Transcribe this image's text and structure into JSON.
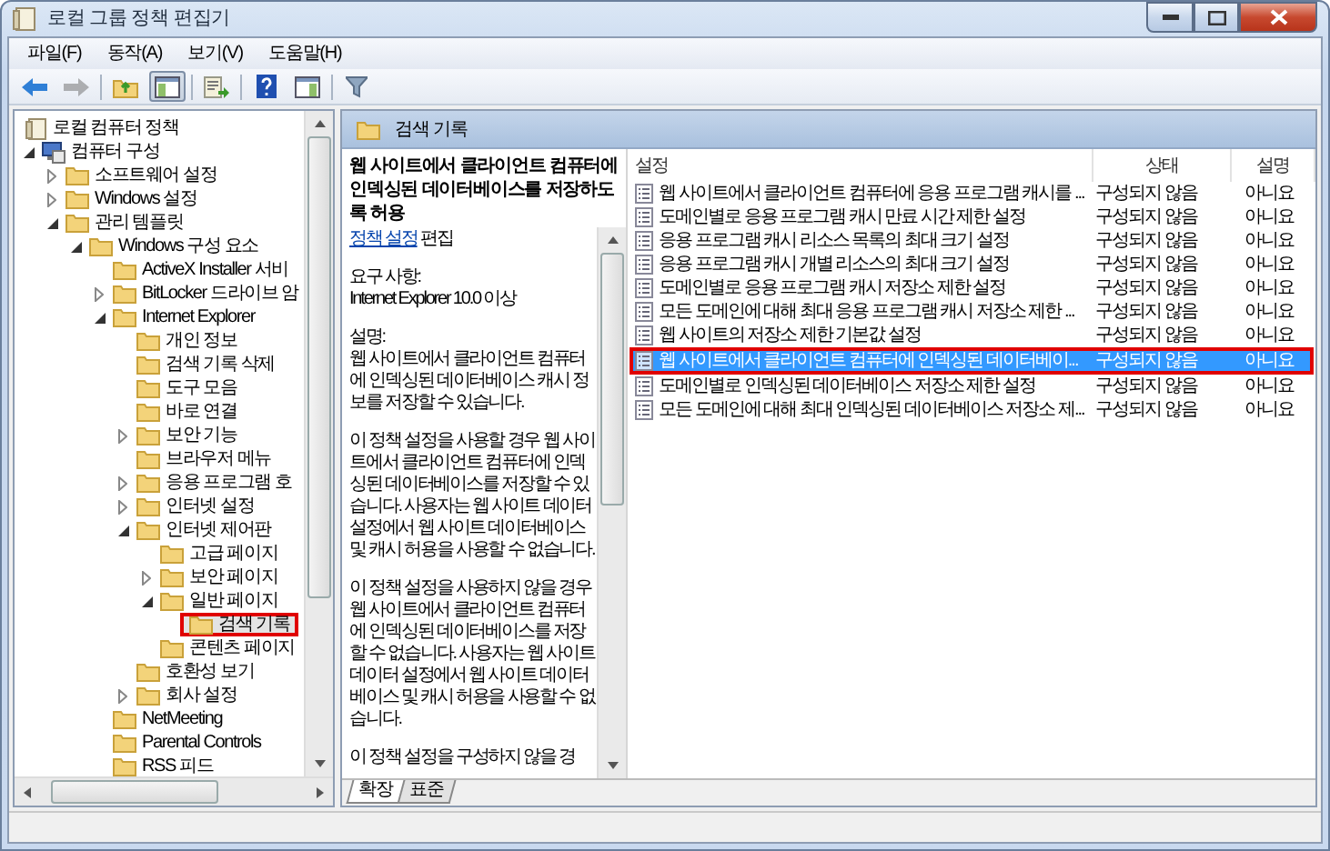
{
  "window": {
    "title": "로컬 그룹 정책 편집기"
  },
  "menu": [
    "파일(F)",
    "동작(A)",
    "보기(V)",
    "도움말(H)"
  ],
  "toolbar": [
    {
      "kind": "back",
      "disabled": false,
      "pressed": false
    },
    {
      "kind": "forward",
      "disabled": true,
      "pressed": false
    },
    {
      "kind": "sep"
    },
    {
      "kind": "up",
      "disabled": false,
      "pressed": false
    },
    {
      "kind": "tree",
      "disabled": false,
      "pressed": true
    },
    {
      "kind": "sep"
    },
    {
      "kind": "export",
      "disabled": false,
      "pressed": false
    },
    {
      "kind": "sep"
    },
    {
      "kind": "help",
      "disabled": false,
      "pressed": false
    },
    {
      "kind": "pane",
      "disabled": false,
      "pressed": false
    },
    {
      "kind": "sep"
    },
    {
      "kind": "filter",
      "disabled": false,
      "pressed": false
    }
  ],
  "tree": [
    {
      "label": "로컬 컴퓨터 정책",
      "kind": "policy",
      "selected": false,
      "highlighted": false,
      "children": [
        {
          "label": "컴퓨터 구성",
          "kind": "computer",
          "expanded": true,
          "selected": false,
          "highlighted": false,
          "children": [
            {
              "label": "소프트웨어 설정",
              "kind": "folder",
              "expanded": false,
              "selected": false,
              "highlighted": false
            },
            {
              "label": "Windows 설정",
              "kind": "folder",
              "expanded": false,
              "selected": false,
              "highlighted": false
            },
            {
              "label": "관리 템플릿",
              "kind": "folder",
              "expanded": true,
              "selected": false,
              "highlighted": false,
              "children": [
                {
                  "label": "Windows 구성 요소",
                  "kind": "folder",
                  "expanded": true,
                  "selected": false,
                  "highlighted": false,
                  "children": [
                    {
                      "label": "ActiveX Installer 서비",
                      "kind": "folder",
                      "selected": false,
                      "highlighted": false
                    },
                    {
                      "label": "BitLocker 드라이브 암",
                      "kind": "folder",
                      "expanded": false,
                      "selected": false,
                      "highlighted": false
                    },
                    {
                      "label": "Internet Explorer",
                      "kind": "folder",
                      "expanded": true,
                      "selected": false,
                      "highlighted": false,
                      "children": [
                        {
                          "label": "개인 정보",
                          "kind": "folder",
                          "selected": false,
                          "highlighted": false
                        },
                        {
                          "label": "검색 기록 삭제",
                          "kind": "folder",
                          "selected": false,
                          "highlighted": false
                        },
                        {
                          "label": "도구 모음",
                          "kind": "folder",
                          "selected": false,
                          "highlighted": false
                        },
                        {
                          "label": "바로 연결",
                          "kind": "folder",
                          "selected": false,
                          "highlighted": false
                        },
                        {
                          "label": "보안 기능",
                          "kind": "folder",
                          "expanded": false,
                          "selected": false,
                          "highlighted": false
                        },
                        {
                          "label": "브라우저 메뉴",
                          "kind": "folder",
                          "selected": false,
                          "highlighted": false
                        },
                        {
                          "label": "응용 프로그램 호",
                          "kind": "folder",
                          "expanded": false,
                          "selected": false,
                          "highlighted": false
                        },
                        {
                          "label": "인터넷 설정",
                          "kind": "folder",
                          "expanded": false,
                          "selected": false,
                          "highlighted": false
                        },
                        {
                          "label": "인터넷 제어판",
                          "kind": "folder",
                          "expanded": true,
                          "selected": false,
                          "highlighted": false,
                          "children": [
                            {
                              "label": "고급 페이지",
                              "kind": "folder",
                              "selected": false,
                              "highlighted": false
                            },
                            {
                              "label": "보안 페이지",
                              "kind": "folder",
                              "expanded": false,
                              "selected": false,
                              "highlighted": false
                            },
                            {
                              "label": "일반 페이지",
                              "kind": "folder",
                              "expanded": true,
                              "selected": false,
                              "highlighted": false,
                              "children": [
                                {
                                  "label": "검색 기록",
                                  "kind": "folder",
                                  "selected": true,
                                  "highlighted": true
                                }
                              ]
                            },
                            {
                              "label": "콘텐츠 페이지",
                              "kind": "folder",
                              "selected": false,
                              "highlighted": false
                            }
                          ]
                        },
                        {
                          "label": "호환성 보기",
                          "kind": "folder",
                          "selected": false,
                          "highlighted": false
                        },
                        {
                          "label": "회사 설정",
                          "kind": "folder",
                          "expanded": false,
                          "selected": false,
                          "highlighted": false
                        }
                      ]
                    },
                    {
                      "label": "NetMeeting",
                      "kind": "folder",
                      "selected": false,
                      "highlighted": false
                    },
                    {
                      "label": "Parental Controls",
                      "kind": "folder",
                      "selected": false,
                      "highlighted": false
                    },
                    {
                      "label": "RSS 피드",
                      "kind": "folder",
                      "selected": false,
                      "highlighted": false
                    }
                  ]
                }
              ]
            }
          ]
        }
      ]
    }
  ],
  "pane": {
    "title": "검색 기록"
  },
  "description": {
    "title": "웹 사이트에서 클라이언트 컴퓨터에 인덱싱된 데이터베이스를 저장하도록 허용",
    "link": "정책 설정",
    "link_suffix": "편집",
    "requirements_label": "요구 사항:",
    "requirements": "Internet Explorer 10.0 이상",
    "description_label": "설명:",
    "paragraphs": [
      "웹 사이트에서 클라이언트 컴퓨터에 인덱싱된 데이터베이스 캐시 정보를 저장할 수 있습니다.",
      "이 정책 설정을 사용할 경우 웹 사이트에서 클라이언트 컴퓨터에 인덱싱된 데이터베이스를 저장할 수 있습니다. 사용자는 웹 사이트 데이터 설정에서 웹 사이트 데이터베이스 및 캐시 허용을 사용할 수 없습니다.",
      "이 정책 설정을 사용하지 않을 경우 웹 사이트에서 클라이언트 컴퓨터에 인덱싱된 데이터베이스를 저장할 수 없습니다. 사용자는 웹 사이트 데이터 설정에서 웹 사이트 데이터베이스 및 캐시 허용을 사용할 수 없습니다.",
      "이 정책 설정을 구성하지 않을 경"
    ]
  },
  "table": {
    "columns": [
      "설정",
      "상태",
      "설명"
    ],
    "rows": [
      {
        "setting": "웹 사이트에서 클라이언트 컴퓨터에 응용 프로그램 캐시를 ...",
        "state": "구성되지 않음",
        "comment": "아니요",
        "selected": false,
        "highlighted": false
      },
      {
        "setting": "도메인별로 응용 프로그램 캐시 만료 시간 제한 설정",
        "state": "구성되지 않음",
        "comment": "아니요",
        "selected": false,
        "highlighted": false
      },
      {
        "setting": "응용 프로그램 캐시 리소스 목록의 최대 크기 설정",
        "state": "구성되지 않음",
        "comment": "아니요",
        "selected": false,
        "highlighted": false
      },
      {
        "setting": "응용 프로그램 캐시 개별 리소스의 최대 크기 설정",
        "state": "구성되지 않음",
        "comment": "아니요",
        "selected": false,
        "highlighted": false
      },
      {
        "setting": "도메인별로 응용 프로그램 캐시 저장소 제한 설정",
        "state": "구성되지 않음",
        "comment": "아니요",
        "selected": false,
        "highlighted": false
      },
      {
        "setting": "모든 도메인에 대해 최대 응용 프로그램 캐시 저장소 제한 ...",
        "state": "구성되지 않음",
        "comment": "아니요",
        "selected": false,
        "highlighted": false
      },
      {
        "setting": "웹 사이트의 저장소 제한 기본값 설정",
        "state": "구성되지 않음",
        "comment": "아니요",
        "selected": false,
        "highlighted": false
      },
      {
        "setting": "웹 사이트에서 클라이언트 컴퓨터에 인덱싱된 데이터베이...",
        "state": "구성되지 않음",
        "comment": "아니요",
        "selected": true,
        "highlighted": true
      },
      {
        "setting": "도메인별로 인덱싱된 데이터베이스 저장소 제한 설정",
        "state": "구성되지 않음",
        "comment": "아니요",
        "selected": false,
        "highlighted": false
      },
      {
        "setting": "모든 도메인에 대해 최대 인덱싱된 데이터베이스 저장소 제...",
        "state": "구성되지 않음",
        "comment": "아니요",
        "selected": false,
        "highlighted": false
      }
    ]
  },
  "view_tabs": [
    {
      "label": "확장",
      "selected": true
    },
    {
      "label": "표준",
      "selected": false
    }
  ]
}
